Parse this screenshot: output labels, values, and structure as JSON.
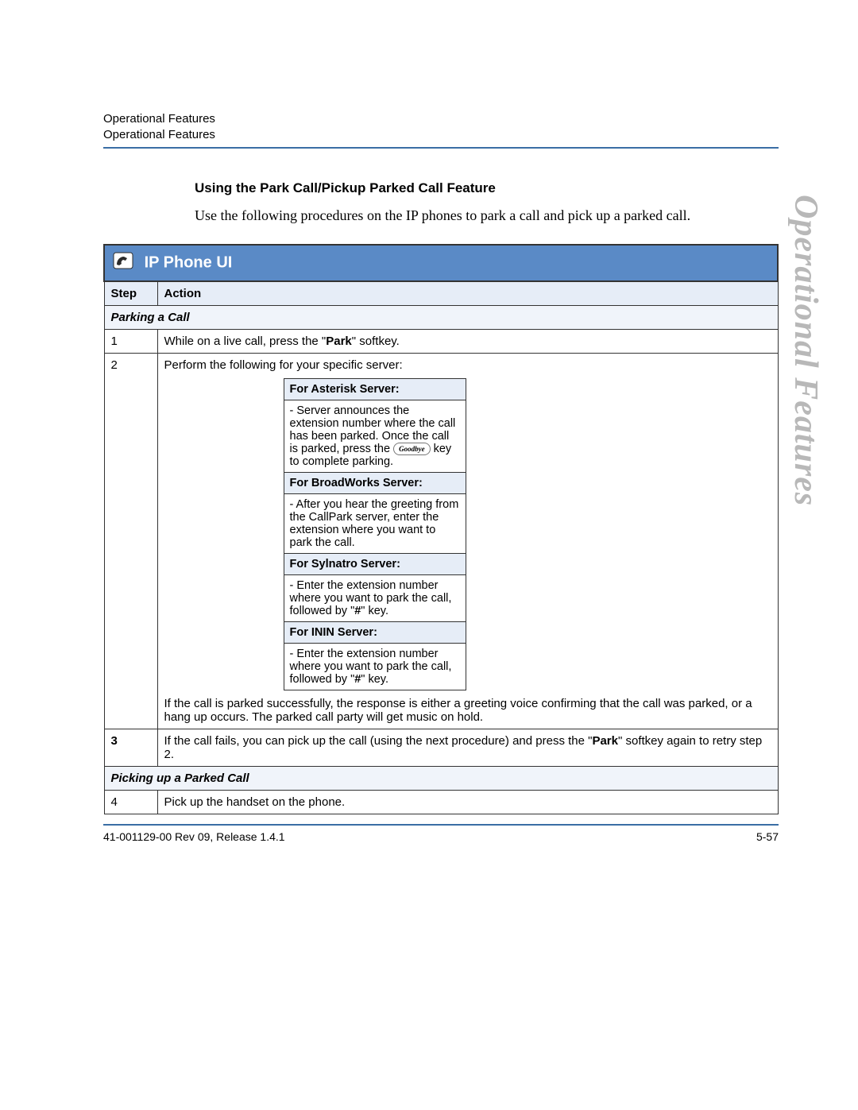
{
  "header": {
    "line1": "Operational Features",
    "line2": "Operational Features"
  },
  "section": {
    "subheading": "Using the Park Call/Pickup Parked Call Feature",
    "intro": "Use the following procedures on the IP phones to park a call and pick up a parked call."
  },
  "table": {
    "title": "IP Phone UI",
    "head_step": "Step",
    "head_action": "Action",
    "section1": "Parking a Call",
    "step1_num": "1",
    "step1_pre": "While on a live call, press the \"",
    "step1_bold": "Park",
    "step1_post": "\" softkey.",
    "step2_num": "2",
    "step2_lead": "Perform the following for your specific server:",
    "servers": {
      "asterisk": {
        "head": "For Asterisk Server:",
        "body_pre": "- Server announces the extension number where the call has been parked. Once the call is parked, press the ",
        "key": "Goodbye",
        "body_post": " key to complete parking."
      },
      "broadworks": {
        "head": "For BroadWorks Server:",
        "body": "- After you hear the greeting from the CallPark server, enter the extension where you want to park the call."
      },
      "sylnatro": {
        "head": "For Sylnatro Server:",
        "body_pre": "- Enter the extension number where you want to park the call, followed by \"",
        "hash": "#",
        "body_post": "\" key."
      },
      "inin": {
        "head": "For ININ Server:",
        "body_pre": "- Enter the extension number where you want to park the call, followed by \"",
        "hash": "#",
        "body_post": "\" key."
      }
    },
    "step2_tail": "If the call is parked successfully, the response is either a greeting voice confirming that the call was parked, or a hang up occurs. The parked call party will get music on hold.",
    "step3_num": "3",
    "step3_pre": "If the call fails, you can pick up the call (using the next procedure) and press the \"",
    "step3_bold": "Park",
    "step3_post": "\" softkey again to retry step 2.",
    "section2": "Picking up a Parked Call",
    "step4_num": "4",
    "step4_action": "Pick up the handset on the phone."
  },
  "footer": {
    "left": "41-001129-00 Rev 09, Release 1.4.1",
    "right": "5-57"
  },
  "side_tab": "Operational Features"
}
